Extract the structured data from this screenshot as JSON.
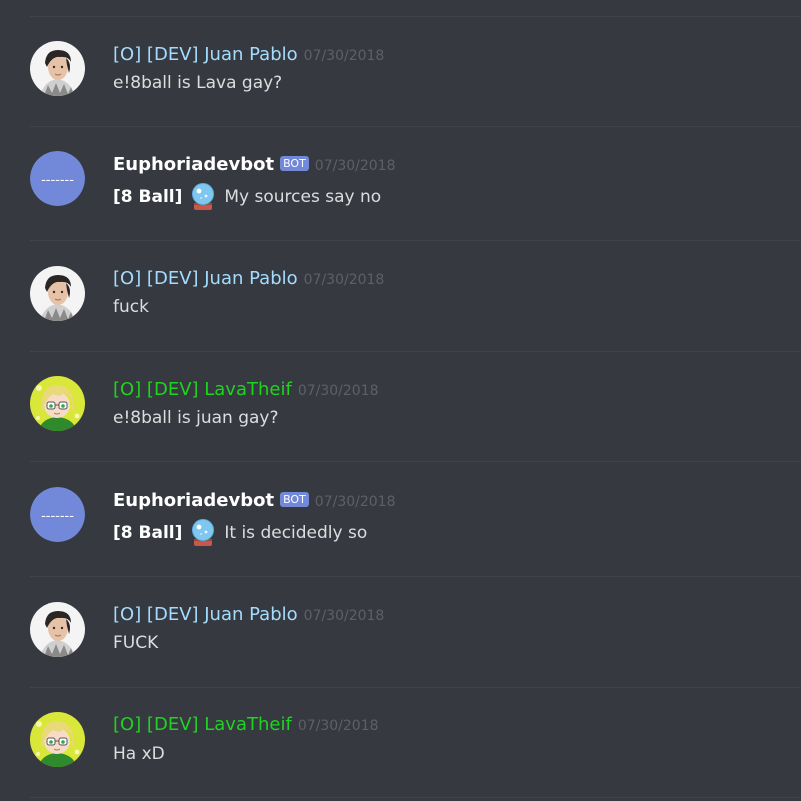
{
  "colors": {
    "background": "#36393f",
    "divider": "#40434a",
    "juan_name": "#a4dcff",
    "lava_name": "#1fd41f",
    "bot_name": "#ffffff",
    "timestamp": "#5e6066",
    "message_text": "#dcddde",
    "bot_tag_bg": "#7289da"
  },
  "messages": [
    {
      "author": "[O] [DEV] Juan Pablo",
      "timestamp": "07/30/2018",
      "text": "e!8ball is Lava gay?",
      "avatar": "juan-avatar"
    },
    {
      "author": "Euphoriadevbot",
      "bot_tag": "BOT",
      "timestamp": "07/30/2018",
      "prefix": "[8 Ball]",
      "icon": "crystal-ball-icon",
      "text": "My sources say no",
      "avatar": "bot-avatar",
      "avatar_text": "-------"
    },
    {
      "author": "[O] [DEV] Juan Pablo",
      "timestamp": "07/30/2018",
      "text": "fuck",
      "avatar": "juan-avatar"
    },
    {
      "author": "[O] [DEV] LavaTheif",
      "timestamp": "07/30/2018",
      "text": "e!8ball is juan gay?",
      "avatar": "lava-avatar"
    },
    {
      "author": "Euphoriadevbot",
      "bot_tag": "BOT",
      "timestamp": "07/30/2018",
      "prefix": "[8 Ball]",
      "icon": "crystal-ball-icon",
      "text": "It is decidedly so",
      "avatar": "bot-avatar",
      "avatar_text": "-------"
    },
    {
      "author": "[O] [DEV] Juan Pablo",
      "timestamp": "07/30/2018",
      "text": "FUCK",
      "avatar": "juan-avatar"
    },
    {
      "author": "[O] [DEV] LavaTheif",
      "timestamp": "07/30/2018",
      "text": "Ha xD",
      "avatar": "lava-avatar"
    }
  ]
}
